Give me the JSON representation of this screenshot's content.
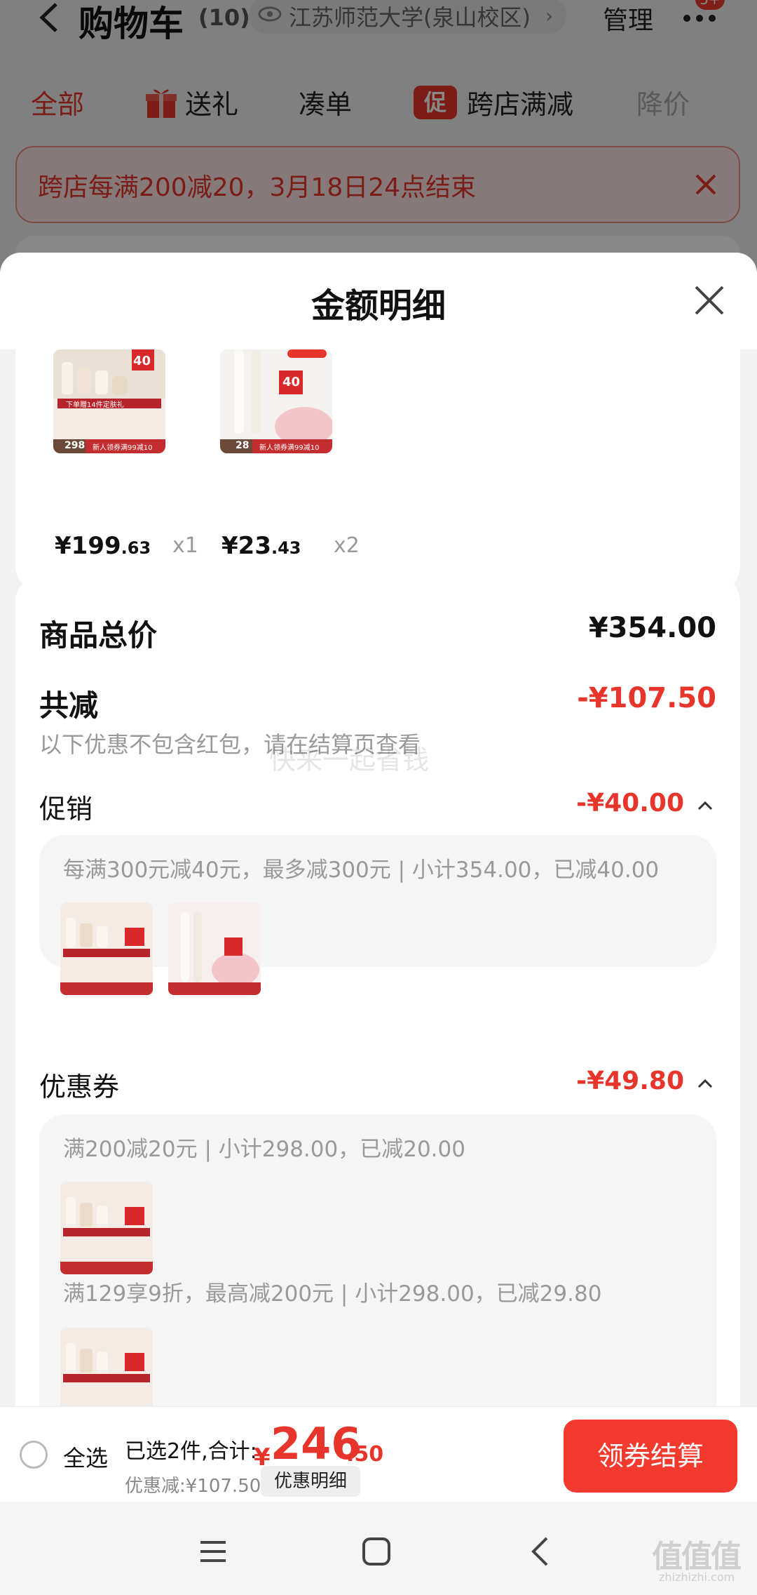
{
  "header": {
    "title": "购物车",
    "count": "(10)",
    "location": "江苏师范大学(泉山校区)",
    "manage": "管理",
    "badge": "5+"
  },
  "tabs": [
    {
      "label": "全部"
    },
    {
      "label": "送礼"
    },
    {
      "label": "凑单"
    },
    {
      "label": "跨店满减",
      "icon_text": "促"
    },
    {
      "label": "降价"
    }
  ],
  "promo_banner": {
    "text": "跨店每满200减20，3月18日24点结束"
  },
  "sheet": {
    "title": "金额明细"
  },
  "products": [
    {
      "price_int": "¥199",
      "price_dec": ".63",
      "qty": "x1",
      "thumb_tag": "40",
      "thumb_price": "298",
      "thumb_caption": "新人领券满99减10",
      "thumb_note": "下单赠14件定肤礼"
    },
    {
      "price_int": "¥23",
      "price_dec": ".43",
      "qty": "x2",
      "thumb_tag": "40",
      "thumb_price": "28",
      "thumb_caption": "新人领券满99减10"
    }
  ],
  "summary": {
    "total_label": "商品总价",
    "total_value": "¥354.00",
    "reduce_label": "共减",
    "reduce_value": "-¥107.50",
    "note": "以下优惠不包含红包，请在结算页查看",
    "promotion": {
      "label": "促销",
      "value": "-¥40.00",
      "rule": "每满300元减40元，最多减300元 | 小计354.00，已减40.00"
    },
    "coupon": {
      "label": "优惠券",
      "value": "-¥49.80",
      "rules": [
        "满200减20元 | 小计298.00，已减20.00",
        "满129享9折，最高减200元 | 小计298.00，已减29.80"
      ]
    }
  },
  "watermark": "快来一起省钱",
  "checkout": {
    "select_all": "全选",
    "selected_info": "已选2件,合计:",
    "currency": "¥",
    "total_int": "246",
    "total_dec": ".50",
    "discount": "优惠减:¥107.50",
    "detail_button": "优惠明细",
    "checkout_button": "领券结算"
  },
  "corner": {
    "logo": "值值值",
    "url": "zhizhizhi.com"
  },
  "colors": {
    "accent": "#e8352b",
    "checkout_button": "#f23a2e"
  }
}
